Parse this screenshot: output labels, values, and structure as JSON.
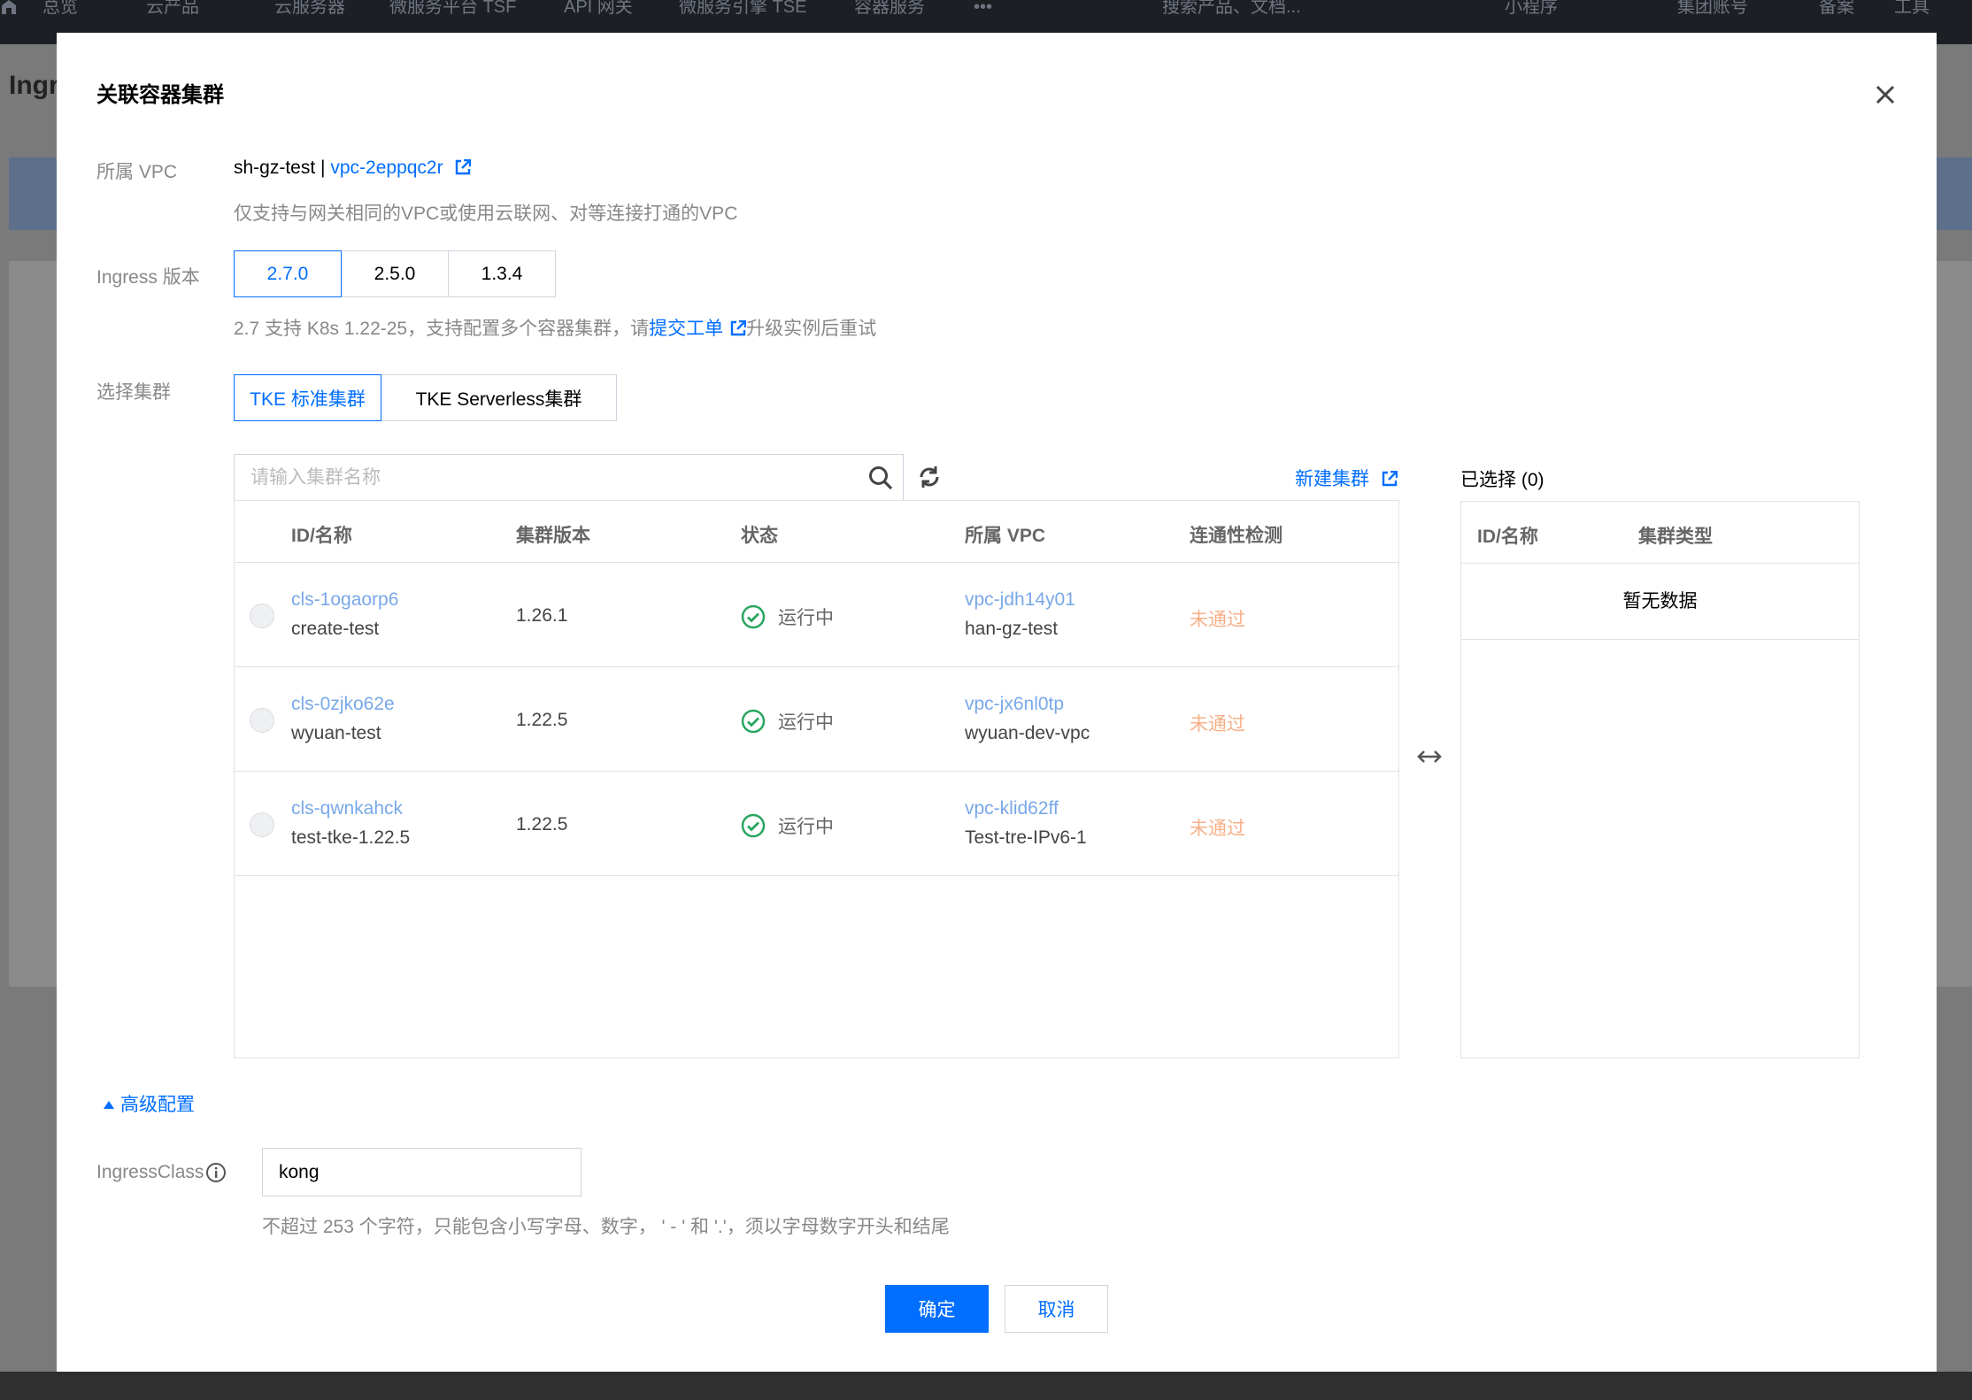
{
  "topnav": {
    "items": [
      "总览",
      "云产品",
      "云服务器",
      "微服务平台 TSF",
      "API 网关",
      "微服务引擎 TSE",
      "容器服务",
      "•••",
      "搜索产品、文档...",
      "小程序",
      "集团账号",
      "备案",
      "工具"
    ]
  },
  "background": {
    "page_title": "Ingr"
  },
  "modal": {
    "title": "关联容器集群",
    "vpc": {
      "label": "所属 VPC",
      "name": "sh-gz-test",
      "separator": "|",
      "id_link": "vpc-2eppqc2r",
      "hint": "仅支持与网关相同的VPC或使用云联网、对等连接打通的VPC"
    },
    "ingress_version": {
      "label": "Ingress 版本",
      "options": [
        "2.7.0",
        "2.5.0",
        "1.3.4"
      ],
      "selected": "2.7.0",
      "hint_prefix": "2.7 支持 K8s 1.22-25，支持配置多个容器集群，请",
      "hint_link": "提交工单",
      "hint_suffix": "升级实例后重试"
    },
    "cluster_select": {
      "label": "选择集群",
      "tabs": [
        "TKE 标准集群",
        "TKE Serverless集群"
      ],
      "selected": "TKE 标准集群"
    },
    "search": {
      "placeholder": "请输入集群名称"
    },
    "new_cluster_link": "新建集群",
    "table": {
      "headers": [
        "ID/名称",
        "集群版本",
        "状态",
        "所属 VPC",
        "连通性检测"
      ],
      "rows": [
        {
          "id": "cls-1ogaorp6",
          "name": "create-test",
          "version": "1.26.1",
          "status": "运行中",
          "vpc_id": "vpc-jdh14y01",
          "vpc_name": "han-gz-test",
          "check": "未通过"
        },
        {
          "id": "cls-0zjko62e",
          "name": "wyuan-test",
          "version": "1.22.5",
          "status": "运行中",
          "vpc_id": "vpc-jx6nl0tp",
          "vpc_name": "wyuan-dev-vpc",
          "check": "未通过"
        },
        {
          "id": "cls-qwnkahck",
          "name": "test-tke-1.22.5",
          "version": "1.22.5",
          "status": "运行中",
          "vpc_id": "vpc-klid62ff",
          "vpc_name": "Test-tre-IPv6-1",
          "check": "未通过"
        }
      ]
    },
    "selected_panel": {
      "title": "已选择 (0)",
      "headers": [
        "ID/名称",
        "集群类型"
      ],
      "empty": "暂无数据"
    },
    "advanced": {
      "toggle": "高级配置"
    },
    "ingress_class": {
      "label": "IngressClass",
      "value": "kong",
      "hint": "不超过 253 个字符，只能包含小写字母、数字， ' - ' 和 '.'，须以字母数字开头和结尾"
    },
    "buttons": {
      "ok": "确定",
      "cancel": "取消"
    }
  },
  "colors": {
    "primary": "#006eff",
    "success": "#29a55f",
    "warning": "#f6b089"
  }
}
